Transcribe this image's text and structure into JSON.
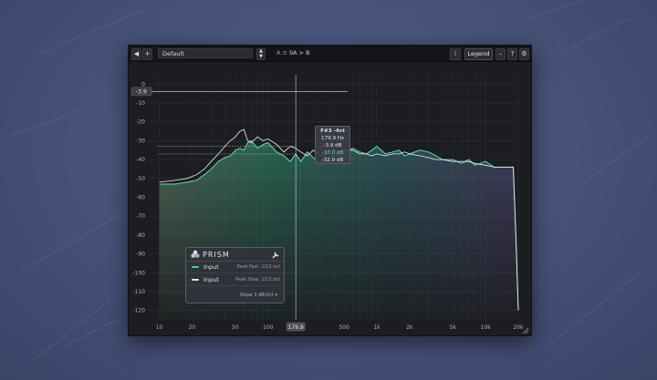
{
  "toolbar": {
    "back_icon": "back-arrow-icon",
    "add_icon": "plus-icon",
    "preset_name": "Default",
    "ab_left": "A ≡ B",
    "ab_compare": "A > B",
    "legend_label": "Legend",
    "minimize_icon": "minimize-icon",
    "help_label": "?",
    "settings_icon": "gear-icon"
  },
  "readout": {
    "threshold": "-3.9",
    "note": "F#3 -4ct",
    "freq": "179.9 Hz",
    "level1": "-3.9 dB",
    "level2": "-37.0 dB",
    "level3": "-32.9 dB",
    "cursor_freq": "179.9"
  },
  "legend_panel": {
    "title": "PRISM",
    "rows": [
      {
        "name": "Input",
        "mode": "Peak Fast, 1/12 oct",
        "color": "#3ed3a4"
      },
      {
        "name": "Input",
        "mode": "Peak Slow, 1/12 oct",
        "color": "#e8e8e8"
      }
    ],
    "slope": "Slope 3 dB/Oct ▾"
  },
  "chart_data": {
    "type": "area",
    "y_ticks": [
      "0",
      "-10",
      "-20",
      "-30",
      "-40",
      "-50",
      "-60",
      "-70",
      "-80",
      "-90",
      "-100",
      "-110",
      "-120"
    ],
    "x_ticks": [
      "10",
      "20",
      "50",
      "100",
      "500",
      "1k",
      "2k",
      "5k",
      "10k",
      "20k"
    ],
    "ylim": [
      -125,
      5
    ],
    "xlim_hz": [
      8,
      20000
    ],
    "grid": true,
    "x": [
      10,
      14,
      18,
      22,
      26,
      30,
      35,
      40,
      45,
      50,
      55,
      60,
      65,
      70,
      80,
      90,
      100,
      120,
      140,
      160,
      179.9,
      200,
      230,
      260,
      300,
      350,
      400,
      450,
      500,
      600,
      700,
      800,
      900,
      1000,
      1200,
      1400,
      1600,
      1800,
      2000,
      2500,
      3000,
      3500,
      4000,
      5000,
      6000,
      7000,
      8000,
      10000,
      12000,
      15000,
      17000,
      18000,
      19000,
      20000
    ],
    "series": [
      {
        "values": [
          -53,
          -53,
          -52,
          -51,
          -48,
          -45,
          -41,
          -39,
          -38,
          -35,
          -34,
          -35,
          -31,
          -30,
          -34,
          -32,
          -31,
          -36,
          -38,
          -41,
          -37,
          -41,
          -36,
          -39,
          -42,
          -37,
          -34,
          -38,
          -36,
          -34,
          -36,
          -37,
          -35,
          -33,
          -37,
          -36,
          -35,
          -38,
          -37,
          -35,
          -36,
          -38,
          -40,
          -40,
          -42,
          -40,
          -43,
          -41,
          -44,
          -44,
          -44,
          -44,
          -80,
          -120
        ]
      },
      {
        "values": [
          -52,
          -51,
          -50,
          -48,
          -45,
          -41,
          -37,
          -33,
          -30,
          -28,
          -25,
          -24,
          -30,
          -31,
          -28,
          -30,
          -29,
          -32,
          -36,
          -33,
          -34,
          -36,
          -38,
          -35,
          -38,
          -36,
          -38,
          -37,
          -35,
          -35,
          -37,
          -37,
          -38,
          -37,
          -38,
          -37,
          -37,
          -36,
          -37,
          -38,
          -39,
          -40,
          -40,
          -41,
          -41,
          -41,
          -42,
          -43,
          -44,
          -44,
          -44,
          -44,
          -80,
          -120
        ]
      }
    ]
  }
}
